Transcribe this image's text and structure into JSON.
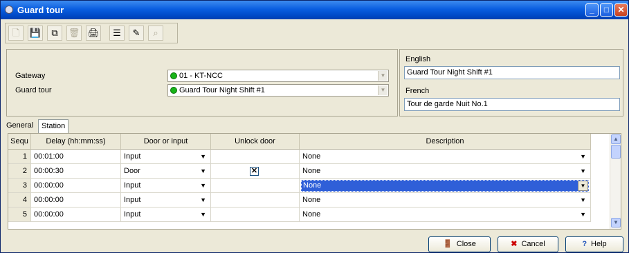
{
  "window": {
    "title": "Guard tour"
  },
  "toolbar": {
    "buttons": [
      {
        "icon": "new-icon",
        "glyph": "🗋",
        "enabled": false
      },
      {
        "icon": "save-icon",
        "glyph": "💾",
        "enabled": true
      },
      {
        "icon": "copy-icon",
        "glyph": "⧉",
        "enabled": true
      },
      {
        "icon": "delete-icon",
        "glyph": "🗑",
        "enabled": false
      },
      {
        "icon": "print-icon",
        "glyph": "🖨",
        "enabled": true
      },
      {
        "icon": "list-icon",
        "glyph": "☰",
        "enabled": true
      },
      {
        "icon": "tools-icon",
        "glyph": "✎",
        "enabled": true
      },
      {
        "icon": "find-icon",
        "glyph": "⌕",
        "enabled": false
      }
    ]
  },
  "form": {
    "gateway_label": "Gateway",
    "gateway_value": "01 - KT-NCC",
    "guard_tour_label": "Guard tour",
    "guard_tour_value": "Guard Tour Night Shift #1",
    "english_label": "English",
    "english_value": "Guard Tour Night Shift #1",
    "french_label": "French",
    "french_value": "Tour de garde Nuit No.1"
  },
  "tabs": [
    "General",
    "Station"
  ],
  "grid": {
    "headers": [
      "Sequ",
      "Delay (hh:mm:ss)",
      "Door or input",
      "Unlock door",
      "Description"
    ],
    "rows": [
      {
        "seq": "1",
        "delay": "00:01:00",
        "door": "Input",
        "unlock": false,
        "desc": "None"
      },
      {
        "seq": "2",
        "delay": "00:00:30",
        "door": "Door",
        "unlock": true,
        "desc": "None"
      },
      {
        "seq": "3",
        "delay": "00:00:00",
        "door": "Input",
        "unlock": false,
        "desc": "None"
      },
      {
        "seq": "4",
        "delay": "00:00:00",
        "door": "Input",
        "unlock": false,
        "desc": "None"
      },
      {
        "seq": "5",
        "delay": "00:00:00",
        "door": "Input",
        "unlock": false,
        "desc": "None"
      }
    ]
  },
  "footer": {
    "close": "Close",
    "cancel": "Cancel",
    "help": "Help"
  }
}
